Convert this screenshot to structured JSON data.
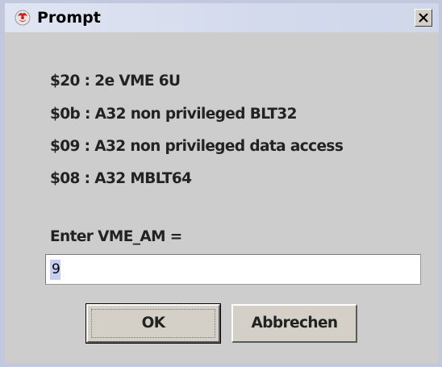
{
  "window": {
    "title": "Prompt",
    "app_icon": "java-duke-icon",
    "close_icon": "close-x-icon"
  },
  "message_lines": [
    "$20 : 2e VME 6U",
    "$0b : A32 non privileged BLT32",
    "$09 : A32 non privileged data access",
    "$08 : A32 MBLT64"
  ],
  "input": {
    "label": "Enter VME_AM =",
    "value": "9"
  },
  "buttons": {
    "ok_label": "OK",
    "cancel_label": "Abbrechen"
  }
}
